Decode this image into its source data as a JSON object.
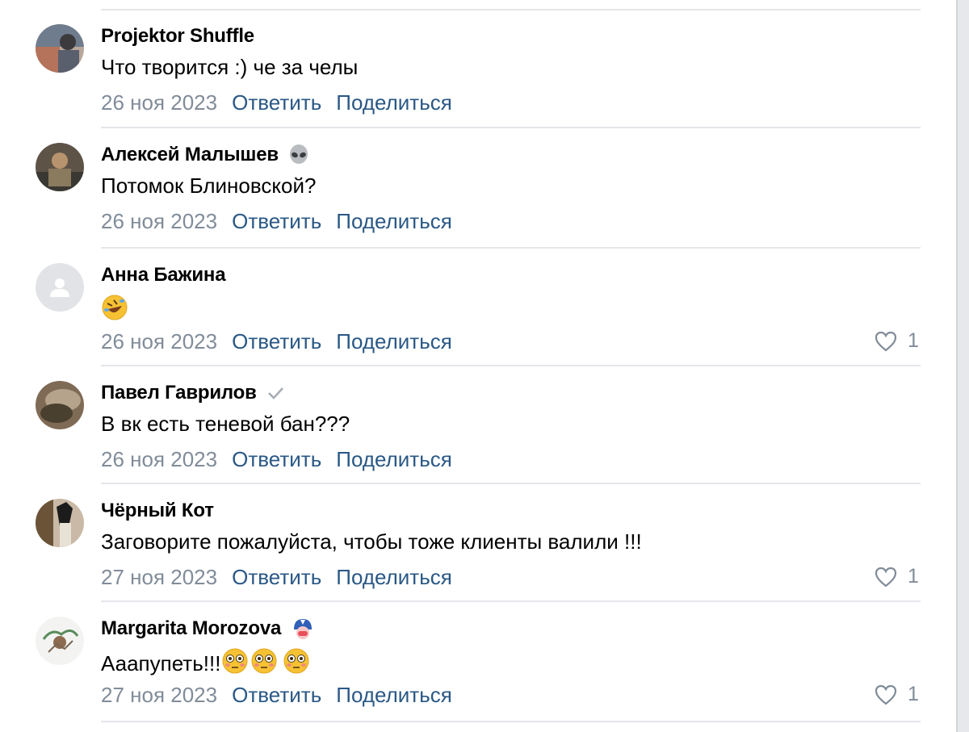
{
  "comments": [
    {
      "author": "Projektor Shuffle",
      "text": "Что творится :) че за челы",
      "date": "26 ноя 2023",
      "reply": "Ответить",
      "share": "Поделиться",
      "likes": ""
    },
    {
      "author": "Алексей Малышев",
      "badge": "alien-icon",
      "text": "Потомок Блиновской?",
      "date": "26 ноя 2023",
      "reply": "Ответить",
      "share": "Поделиться",
      "likes": ""
    },
    {
      "author": "Анна Бажина",
      "text_emoji": "rolling-on-floor-laughing-emoji",
      "date": "26 ноя 2023",
      "reply": "Ответить",
      "share": "Поделиться",
      "likes": "1"
    },
    {
      "author": "Павел Гаврилов",
      "badge": "checkmark-icon",
      "text": "В вк есть теневой бан???",
      "date": "26 ноя 2023",
      "reply": "Ответить",
      "share": "Поделиться",
      "likes": ""
    },
    {
      "author": "Чёрный Кот",
      "text": "Заговорите пожалуйста, чтобы тоже клиенты валили !!!",
      "date": "27 ноя 2023",
      "reply": "Ответить",
      "share": "Поделиться",
      "likes": "1"
    },
    {
      "author": "Margarita Morozova",
      "badge": "helmet-emoji-icon",
      "text": "Ааапупеть!!!",
      "text_emoji": "flushed-face-emoji",
      "date": "27 ноя 2023",
      "reply": "Ответить",
      "share": "Поделиться",
      "likes": "1"
    }
  ],
  "colors": {
    "link": "#2a5885",
    "meta": "#818c99",
    "divider": "#e4e6ea"
  }
}
